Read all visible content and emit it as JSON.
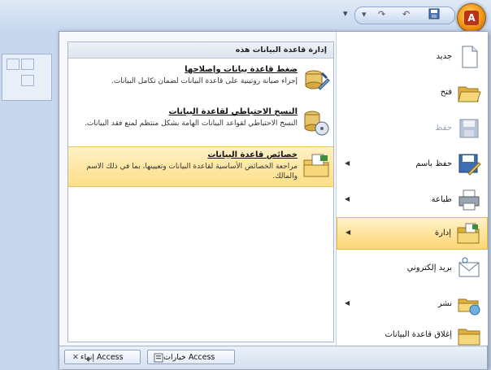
{
  "quick_access": {
    "save_icon": "save-icon",
    "undo_icon": "undo-icon",
    "redo_icon": "redo-icon",
    "dropdown": "▾"
  },
  "panel": {
    "header": "إدارة قاعدة البيانات هذه",
    "items": [
      {
        "title": "ضغط قاعدة بيانات وإصلاحها",
        "desc": "إجراء صيانة روتينية على قاعدة البيانات لضمان تكامل البيانات."
      },
      {
        "title": "النسخ الاحتياطي لقاعدة البيانات",
        "desc": "النسخ الاحتياطي لقواعد البيانات الهامة بشكل منتظم لمنع فقد البيانات."
      },
      {
        "title": "خصائص قاعدة البيانات",
        "desc": "مراجعة الخصائص الأساسية لقاعدة البيانات وتعيينها، بما في ذلك الاسم والمالك."
      }
    ]
  },
  "menu": {
    "items": [
      {
        "label": "جديد"
      },
      {
        "label": "فتح"
      },
      {
        "label": "حفظ"
      },
      {
        "label": "حفظ باسم"
      },
      {
        "label": "طباعة"
      },
      {
        "label": "إدارة"
      },
      {
        "label": "بريد إلكتروني"
      },
      {
        "label": "نشر"
      },
      {
        "label": "إغلاق قاعدة البيانات"
      }
    ]
  },
  "footer": {
    "options_label": "خيارات Access",
    "exit_label": "إنهاء Access"
  },
  "colors": {
    "highlight": "#fddf88",
    "border": "#8fa3c1"
  }
}
